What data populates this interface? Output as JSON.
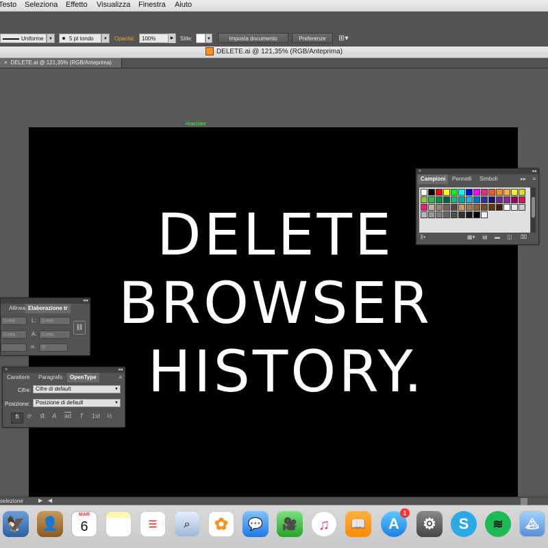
{
  "menu": [
    "Testo",
    "Seleziona",
    "Effetto",
    "Visualizza",
    "Finestra",
    "Aiuto"
  ],
  "control": {
    "stroke_style": "Uniforme",
    "brush": "5 pt tondo",
    "opacity_label": "Opacità:",
    "opacity_value": "100%",
    "style_label": "Stile:",
    "doc_setup_button": "Imposta documento",
    "prefs_button": "Preferenze"
  },
  "window_title": "DELETE.ai @ 121,35% (RGB/Anteprima)",
  "doc_tab": "DELETE.ai @ 121,35% (RGB/Anteprima)",
  "artboard": {
    "lines": [
      "DELETE",
      "BROWSER",
      "HISTORY."
    ],
    "anchor_label": "tracciato"
  },
  "swatches_panel": {
    "tabs": [
      "Campioni",
      "Pennelli",
      "Simboli"
    ],
    "colors": [
      "#ffffff",
      "#000000",
      "#ff0000",
      "#ffff00",
      "#00ff00",
      "#00ffff",
      "#0000ff",
      "#ff00ff",
      "#ee2a7b",
      "#f15a24",
      "#f7931e",
      "#fbb03b",
      "#fcee21",
      "#d9e021",
      "#8cc63f",
      "#39b54a",
      "#009245",
      "#006837",
      "#22b573",
      "#00a99d",
      "#29abe2",
      "#0071bc",
      "#2e3192",
      "#1b1464",
      "#662d91",
      "#93278f",
      "#9e005d",
      "#d4145a",
      "#ed1e79",
      "#c7b299",
      "#998675",
      "#736357",
      "#534741",
      "#c69c6d",
      "#a67c52",
      "#8c6239",
      "#754c24",
      "#603813",
      "#42210b",
      "#ffffff",
      "#e6e6e6",
      "#cccccc",
      "#b3b3b3",
      "#999999",
      "#808080",
      "#666666",
      "#4d4d4d",
      "#333333",
      "#1a1a1a",
      "#000000",
      "#f2f2f2"
    ]
  },
  "align_panel": {
    "tabs": [
      "Allinea",
      "Elaborazione tr"
    ],
    "fields": [
      "0 mm",
      "0 mm",
      "0 mm",
      "0 mm",
      "0°"
    ],
    "field_labels": [
      "L:",
      "A:"
    ]
  },
  "opentype_panel": {
    "tabs": [
      "Carattere",
      "Paragrafo",
      "OpenType"
    ],
    "figures_label": "Cifre:",
    "figures_value": "Cifre di default",
    "position_label": "Posizione:",
    "position_value": "Posizione di default",
    "glyph_buttons": [
      "ﬁ",
      "ơ",
      "ﬆ",
      "A",
      "ad",
      "T",
      "1st",
      "½"
    ]
  },
  "status": {
    "tool": "selezione"
  },
  "dock": {
    "calendar_month": "MAR",
    "calendar_day": "6",
    "appstore_badge": "1",
    "apps": [
      "Finder-eagle",
      "Contacts",
      "Calendar",
      "Notes",
      "Reminders",
      "Preview",
      "Photos",
      "Messages",
      "FaceTime",
      "iTunes",
      "iBooks",
      "App Store",
      "System Preferences",
      "Skype",
      "Spotify",
      "Photos2"
    ]
  }
}
